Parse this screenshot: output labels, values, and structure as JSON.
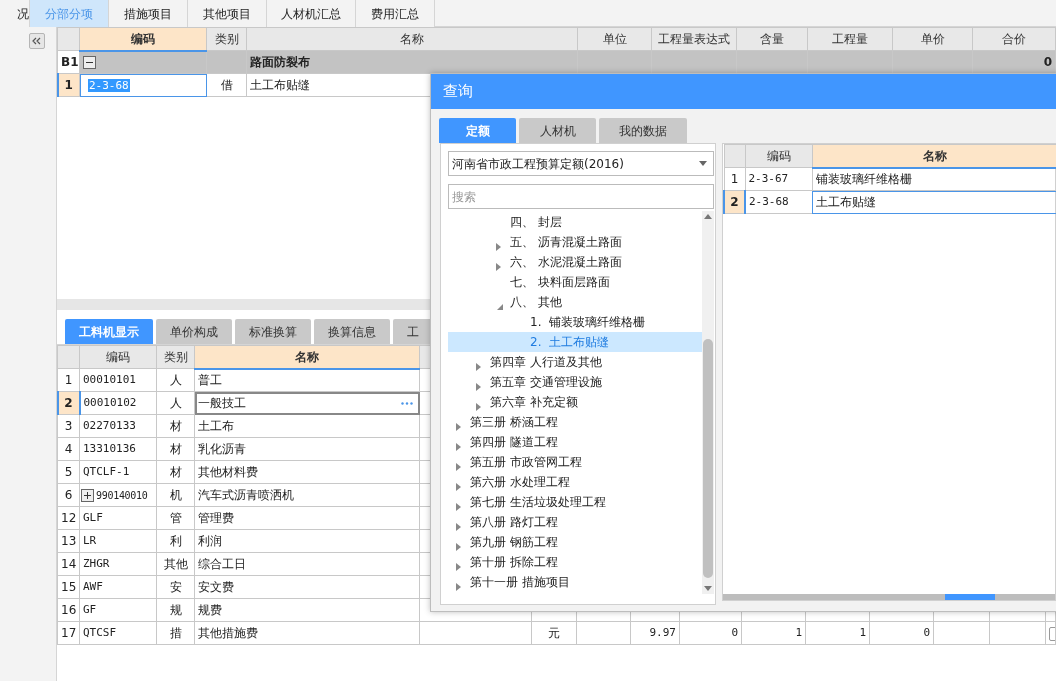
{
  "top_tabs": [
    {
      "label": "况",
      "selected": false
    },
    {
      "label": "分部分项",
      "selected": true
    },
    {
      "label": "措施项目",
      "selected": false
    },
    {
      "label": "其他项目",
      "selected": false
    },
    {
      "label": "人材机汇总",
      "selected": false
    },
    {
      "label": "费用汇总",
      "selected": false
    }
  ],
  "upper_grid": {
    "columns": [
      {
        "label": "编码",
        "selected": true
      },
      {
        "label": "类别",
        "selected": false
      },
      {
        "label": "名称",
        "selected": false
      },
      {
        "label": "单位",
        "selected": false
      },
      {
        "label": "工程量表达式",
        "selected": false
      },
      {
        "label": "含量",
        "selected": false
      },
      {
        "label": "工程量",
        "selected": false
      },
      {
        "label": "单价",
        "selected": false
      },
      {
        "label": "合价",
        "selected": false
      }
    ],
    "rows": [
      {
        "kind": "group",
        "num": "B1",
        "expanded": true,
        "selected": false,
        "cells": [
          "",
          "",
          "路面防裂布",
          "",
          "",
          "",
          "",
          "",
          "0"
        ]
      },
      {
        "kind": "item",
        "num": "1",
        "selected": true,
        "cells": [
          "2-3-68",
          "借",
          "土工布贴缝"
        ]
      }
    ]
  },
  "lower_tabs": [
    {
      "label": "工料机显示",
      "selected": true
    },
    {
      "label": "单价构成",
      "selected": false
    },
    {
      "label": "标准换算",
      "selected": false
    },
    {
      "label": "换算信息",
      "selected": false
    },
    {
      "label": "工",
      "selected": false
    }
  ],
  "lower_grid": {
    "columns": [
      {
        "label": "编码",
        "selected": false
      },
      {
        "label": "类别",
        "selected": false
      },
      {
        "label": "名称",
        "selected": true
      }
    ],
    "rows": [
      {
        "num": "1",
        "selected": false,
        "cells": [
          "00010101",
          "人",
          "普工"
        ]
      },
      {
        "num": "2",
        "selected": true,
        "cells": [
          "00010102",
          "人",
          "一般技工"
        ]
      },
      {
        "num": "3",
        "selected": false,
        "cells": [
          "02270133",
          "材",
          "土工布"
        ]
      },
      {
        "num": "4",
        "selected": false,
        "cells": [
          "13310136",
          "材",
          "乳化沥青"
        ]
      },
      {
        "num": "5",
        "selected": false,
        "cells": [
          "QTCLF-1",
          "材",
          "其他材料费"
        ]
      },
      {
        "num": "6",
        "selected": false,
        "expanded": false,
        "cells": [
          "990140010",
          "机",
          "汽车式沥青喷洒机"
        ]
      },
      {
        "num": "12",
        "selected": false,
        "cells": [
          "GLF",
          "管",
          "管理费"
        ]
      },
      {
        "num": "13",
        "selected": false,
        "cells": [
          "LR",
          "利",
          "利润"
        ]
      },
      {
        "num": "14",
        "selected": false,
        "cells": [
          "ZHGR",
          "其他",
          "综合工日"
        ]
      },
      {
        "num": "15",
        "selected": false,
        "cells": [
          "AWF",
          "安",
          "安文费"
        ]
      },
      {
        "num": "16",
        "selected": false,
        "cells": [
          "GF",
          "规",
          "规费"
        ]
      },
      {
        "num": "17",
        "selected": false,
        "checked": false,
        "cells": [
          "QTCSF",
          "措",
          "其他措施费",
          "",
          "元",
          "",
          "9.97",
          "0",
          "1",
          "1",
          "0",
          ""
        ]
      }
    ]
  },
  "dialog": {
    "title": "查询",
    "tabs": [
      {
        "label": "定额",
        "selected": true
      },
      {
        "label": "人材机",
        "selected": false
      },
      {
        "label": "我的数据",
        "selected": false
      }
    ],
    "quota_select": {
      "value": "河南省市政工程预算定额(2016)"
    },
    "search": {
      "placeholder": "搜索"
    },
    "tree": [
      {
        "children": [
          {
            "children": [
              {
                "label": "四、 封层",
                "selected": false
              },
              {
                "label": "五、 沥青混凝土路面",
                "selected": false,
                "expanded": false
              },
              {
                "label": "六、 水泥混凝土路面",
                "selected": false,
                "expanded": false
              },
              {
                "label": "七、 块料面层路面",
                "selected": false
              },
              {
                "label": "八、 其他",
                "selected": false,
                "expanded": true,
                "children": [
                  {
                    "label": "1.  铺装玻璃纤维格栅",
                    "selected": false
                  },
                  {
                    "label": "2.  土工布贴缝",
                    "selected": true
                  }
                ]
              }
            ]
          },
          {
            "label": "第四章 人行道及其他",
            "selected": false,
            "expanded": false
          },
          {
            "label": "第五章 交通管理设施",
            "selected": false,
            "expanded": false
          },
          {
            "label": "第六章 补充定额",
            "selected": false,
            "expanded": false
          }
        ]
      },
      {
        "label": "第三册 桥涵工程",
        "selected": false,
        "expanded": false
      },
      {
        "label": "第四册 隧道工程",
        "selected": false,
        "expanded": false
      },
      {
        "label": "第五册 市政管网工程",
        "selected": false,
        "expanded": false
      },
      {
        "label": "第六册 水处理工程",
        "selected": false,
        "expanded": false
      },
      {
        "label": "第七册 生活垃圾处理工程",
        "selected": false,
        "expanded": false
      },
      {
        "label": "第八册 路灯工程",
        "selected": false,
        "expanded": false
      },
      {
        "label": "第九册 钢筋工程",
        "selected": false,
        "expanded": false
      },
      {
        "label": "第十册 拆除工程",
        "selected": false,
        "expanded": false
      },
      {
        "label": "第十一册 措施项目",
        "selected": false,
        "expanded": false
      }
    ],
    "result_grid": {
      "columns": [
        {
          "label": "编码",
          "selected": false
        },
        {
          "label": "名称",
          "selected": true
        }
      ],
      "rows": [
        {
          "num": "1",
          "selected": false,
          "cells": [
            "2-3-67",
            "铺装玻璃纤维格栅"
          ]
        },
        {
          "num": "2",
          "selected": true,
          "cells": [
            "2-3-68",
            "土工布贴缝"
          ]
        }
      ]
    }
  }
}
